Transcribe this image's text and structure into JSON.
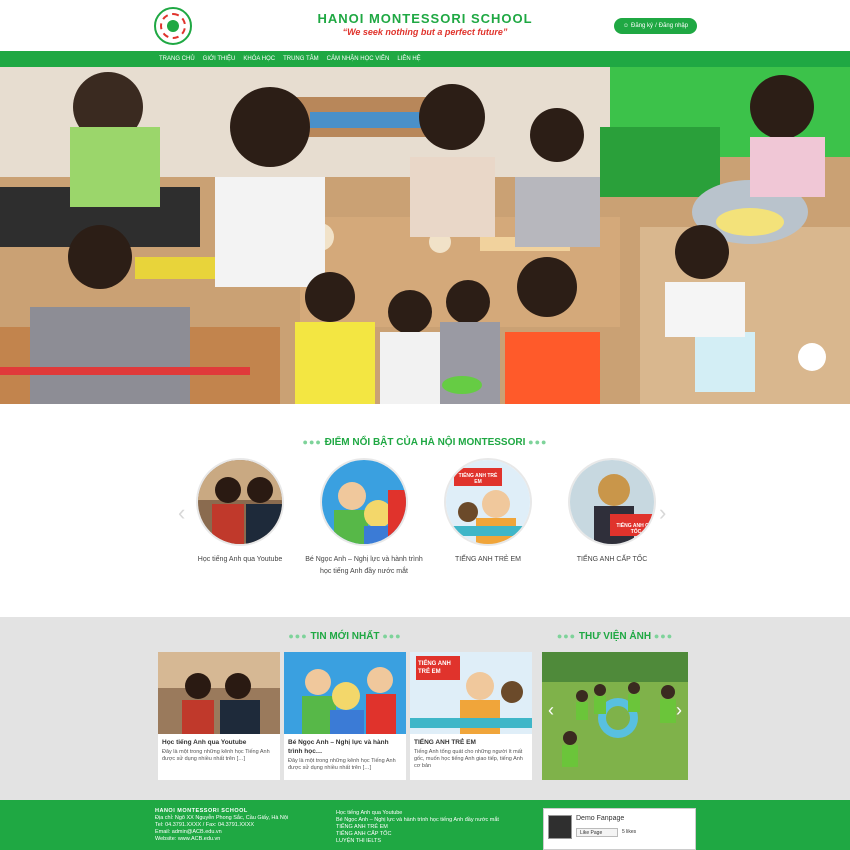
{
  "header": {
    "school_name": "HANOI MONTESSORI SCHOOL",
    "tagline": "“We seek nothing but a perfect future”",
    "register_label": "Đăng ký",
    "separator": "/",
    "login_label": "Đăng nhập"
  },
  "nav": {
    "items": [
      {
        "label": "TRANG CHỦ"
      },
      {
        "label": "GIỚI THIỆU"
      },
      {
        "label": "KHÓA HỌC"
      },
      {
        "label": "TRUNG TÂM"
      },
      {
        "label": "CẢM NHẬN HỌC VIÊN"
      },
      {
        "label": "LIÊN HỆ"
      }
    ]
  },
  "highlights": {
    "title": "ĐIỂM NỔI BẬT CỦA HÀ NỘI MONTESSORI",
    "items": [
      {
        "caption": "Học tiếng Anh qua Youtube"
      },
      {
        "caption": "Bé Ngọc Anh – Nghị lực và hành trình học tiếng Anh đầy nước mắt"
      },
      {
        "caption": "TIẾNG ANH TRẺ EM",
        "overlay": "TIẾNG ANH TRẺ EM"
      },
      {
        "caption": "TIẾNG ANH CẤP TỐC",
        "overlay": "TIẾNG ANH CẤP TỐC"
      }
    ]
  },
  "news": {
    "title": "TIN MỚI NHẤT",
    "items": [
      {
        "title": "Học tiếng Anh qua Youtube",
        "desc": "Đây là một trong những kênh học Tiếng Anh được sử dụng nhiều nhất trên […]"
      },
      {
        "title": "Bé Ngọc Anh – Nghị lực và hành trình học…",
        "desc": "Đây là một trong những kênh học Tiếng Anh được sử dụng nhiều nhất trên […]"
      },
      {
        "title": "TIẾNG ANH TRẺ EM",
        "desc": "Tiếng Anh tổng quát cho những người ít mất gốc, muốn học tiếng Anh giao tiếp, tiếng Anh cơ bản",
        "overlay": "TIẾNG ANH TRẺ EM"
      }
    ]
  },
  "gallery": {
    "title": "THƯ VIỆN ẢNH"
  },
  "footer": {
    "school_name": "HANOI MONTESSORI SCHOOL",
    "address": "Địa chỉ: Ngõ XX Nguyễn Phong Sắc, Cầu Giấy, Hà Nội",
    "phone": "Tel: 04.3791.XXXX / Fax: 04.3791.XXXX",
    "email": "Email: admin@ACB.edu.vn",
    "website": "Website: www.ACB.edu.vn",
    "links": [
      {
        "label": "Học tiếng Anh qua Youtube"
      },
      {
        "label": "Bé Ngọc Anh – Nghị lực và hành trình học tiếng Anh đầy nước mắt"
      },
      {
        "label": "TIẾNG ANH TRẺ EM"
      },
      {
        "label": "TIẾNG ANH CẤP TỐC"
      },
      {
        "label": "LUYỆN THI IELTS"
      }
    ],
    "fb": {
      "name": "Demo Fanpage",
      "like_label": "Like Page",
      "likes": "5 likes"
    }
  },
  "colors": {
    "brand_green": "#1fa843",
    "accent_red": "#e0332c",
    "band_grey": "#e3e3e3"
  }
}
